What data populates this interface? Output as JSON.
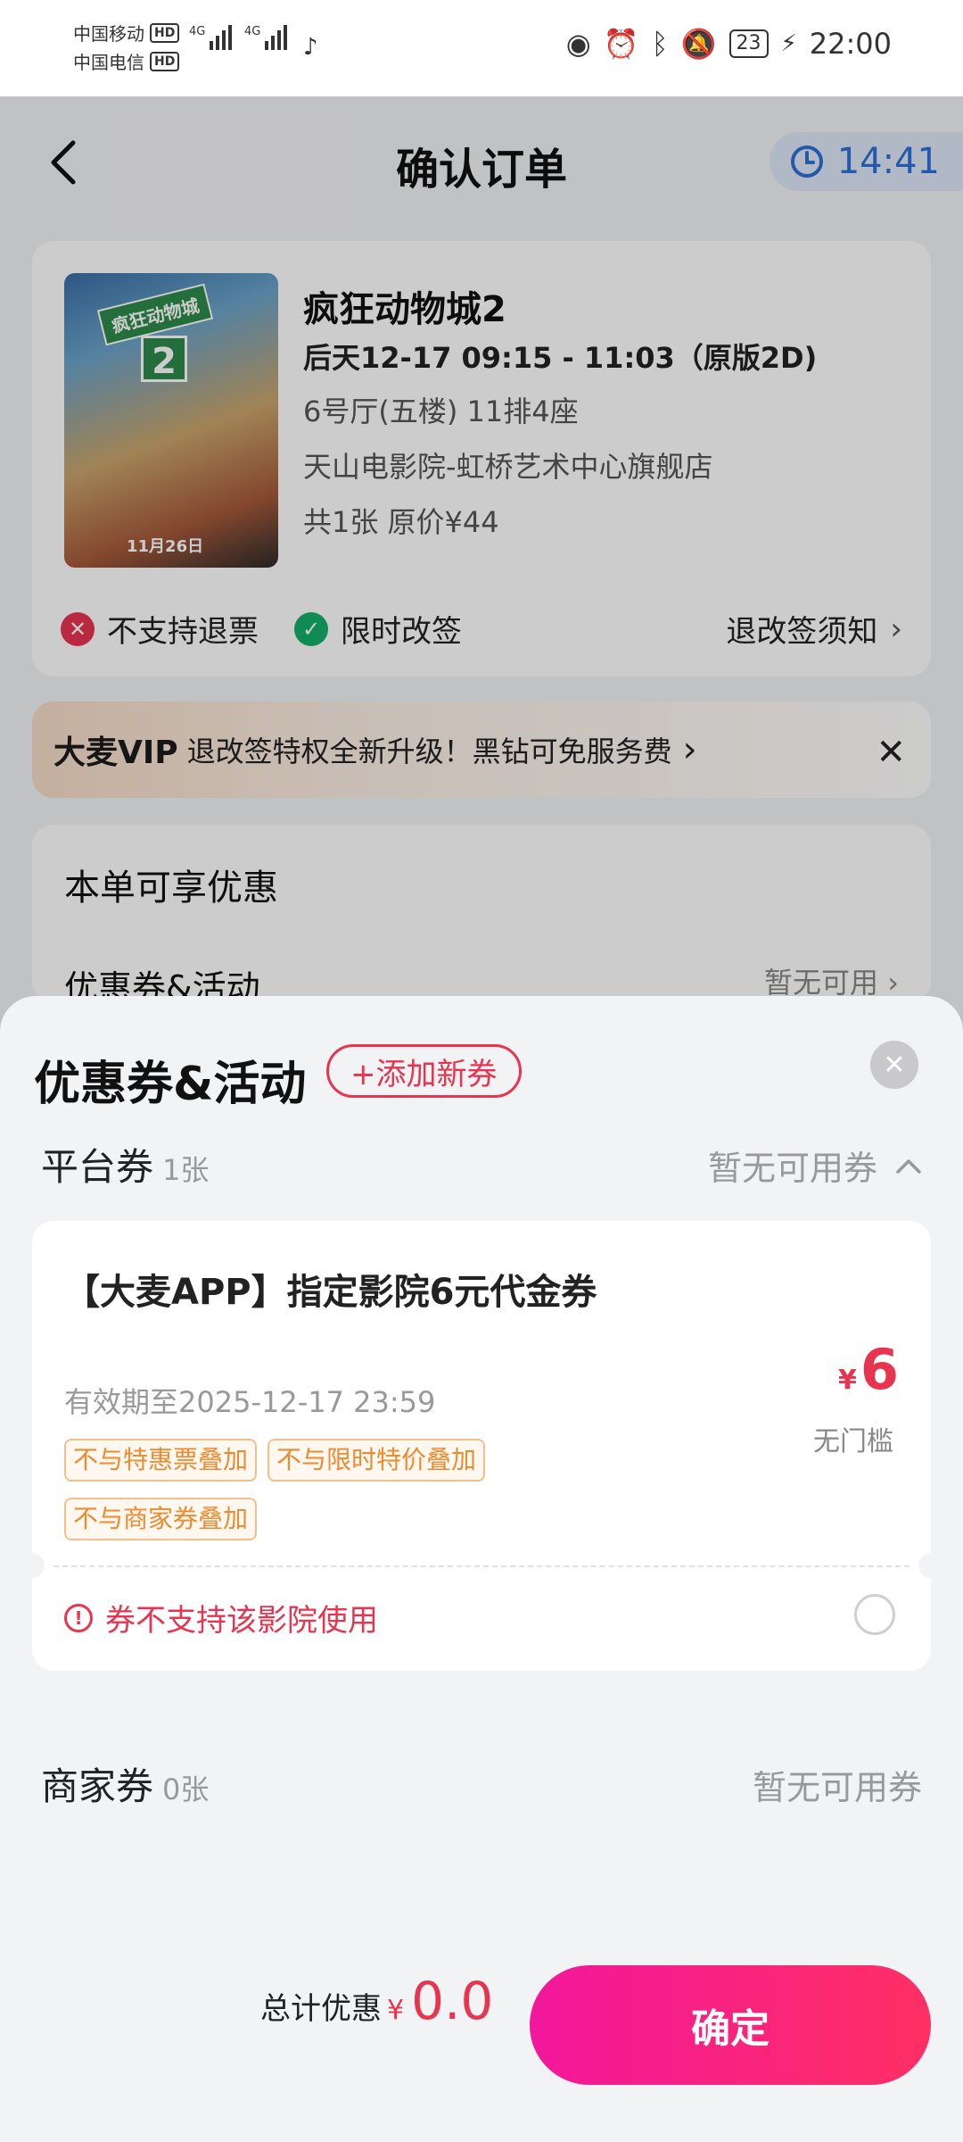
{
  "status_bar": {
    "carrier1": "中国移动",
    "carrier2": "中国电信",
    "hd": "HD",
    "net1": "4G",
    "net2": "4G",
    "battery": "23",
    "time": "22:00"
  },
  "header": {
    "title": "确认订单",
    "timer": "14:41"
  },
  "movie": {
    "poster_title": "疯狂动物城",
    "poster_number": "2",
    "poster_date": "11月26日",
    "title": "疯狂动物城2",
    "showtime": "后天12-17 09:15 - 11:03（原版2D)",
    "hall": "6号厅(五楼) 11排4座",
    "cinema": "天山电影院-虹桥艺术中心旗舰店",
    "price_info": "共1张 原价¥44",
    "no_refund": "不支持退票",
    "limited_change": "限时改签",
    "notice": "退改签须知"
  },
  "vip_banner": {
    "brand": "大麦VIP",
    "text": "退改签特权全新升级！黑钻可免服务费"
  },
  "discount": {
    "title": "本单可享优惠",
    "row_label": "优惠券&活动",
    "row_status": "暂无可用"
  },
  "sheet": {
    "title": "优惠券&活动",
    "add_button": "+添加新券",
    "platform": {
      "name": "平台券",
      "count": "1张",
      "status": "暂无可用券"
    },
    "coupon": {
      "name": "【大麦APP】指定影院6元代金券",
      "validity": "有效期至2025-12-17 23:59",
      "tags": [
        "不与特惠票叠加",
        "不与限时特价叠加",
        "不与商家券叠加"
      ],
      "currency": "¥",
      "amount": "6",
      "threshold": "无门槛",
      "warning": "券不支持该影院使用"
    },
    "merchant": {
      "name": "商家券",
      "count": "0张",
      "status": "暂无可用券"
    },
    "footer": {
      "total_label": "总计优惠",
      "currency": "¥",
      "total_value": "0.0",
      "confirm": "确定"
    }
  },
  "colors": {
    "accent": "#e8344f",
    "confirm_start": "#f2179c",
    "confirm_end": "#ff2f63",
    "timer": "#2c6fd6"
  }
}
